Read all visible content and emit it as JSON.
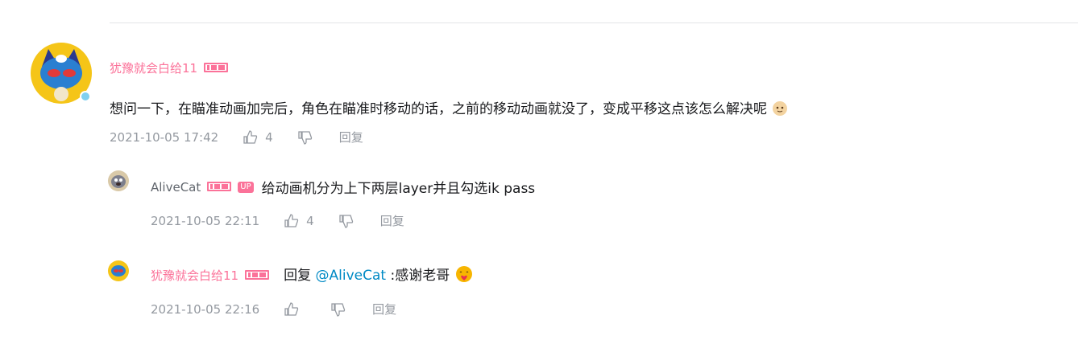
{
  "comment": {
    "username": "犹豫就会白给11",
    "text": "想问一下，在瞄准动画加完后，角色在瞄准时移动的话，之前的移动动画就没了，变成平移这点该怎么解决呢",
    "time": "2021-10-05 17:42",
    "likes": "4",
    "reply_label": "回复"
  },
  "replies": [
    {
      "username": "AliveCat",
      "up_label": "UP",
      "text": "给动画机分为上下两层layer并且勾选ik pass",
      "time": "2021-10-05 22:11",
      "likes": "4",
      "reply_label": "回复"
    },
    {
      "username": "犹豫就会白给11",
      "prefix": "回复 ",
      "mention": "@AliveCat",
      "text": " :感谢老哥",
      "time": "2021-10-05 22:16",
      "likes": "",
      "reply_label": "回复"
    }
  ],
  "colors": {
    "vip_name": "#fb7299",
    "meta": "#9499a0",
    "mention": "#008ac5"
  }
}
